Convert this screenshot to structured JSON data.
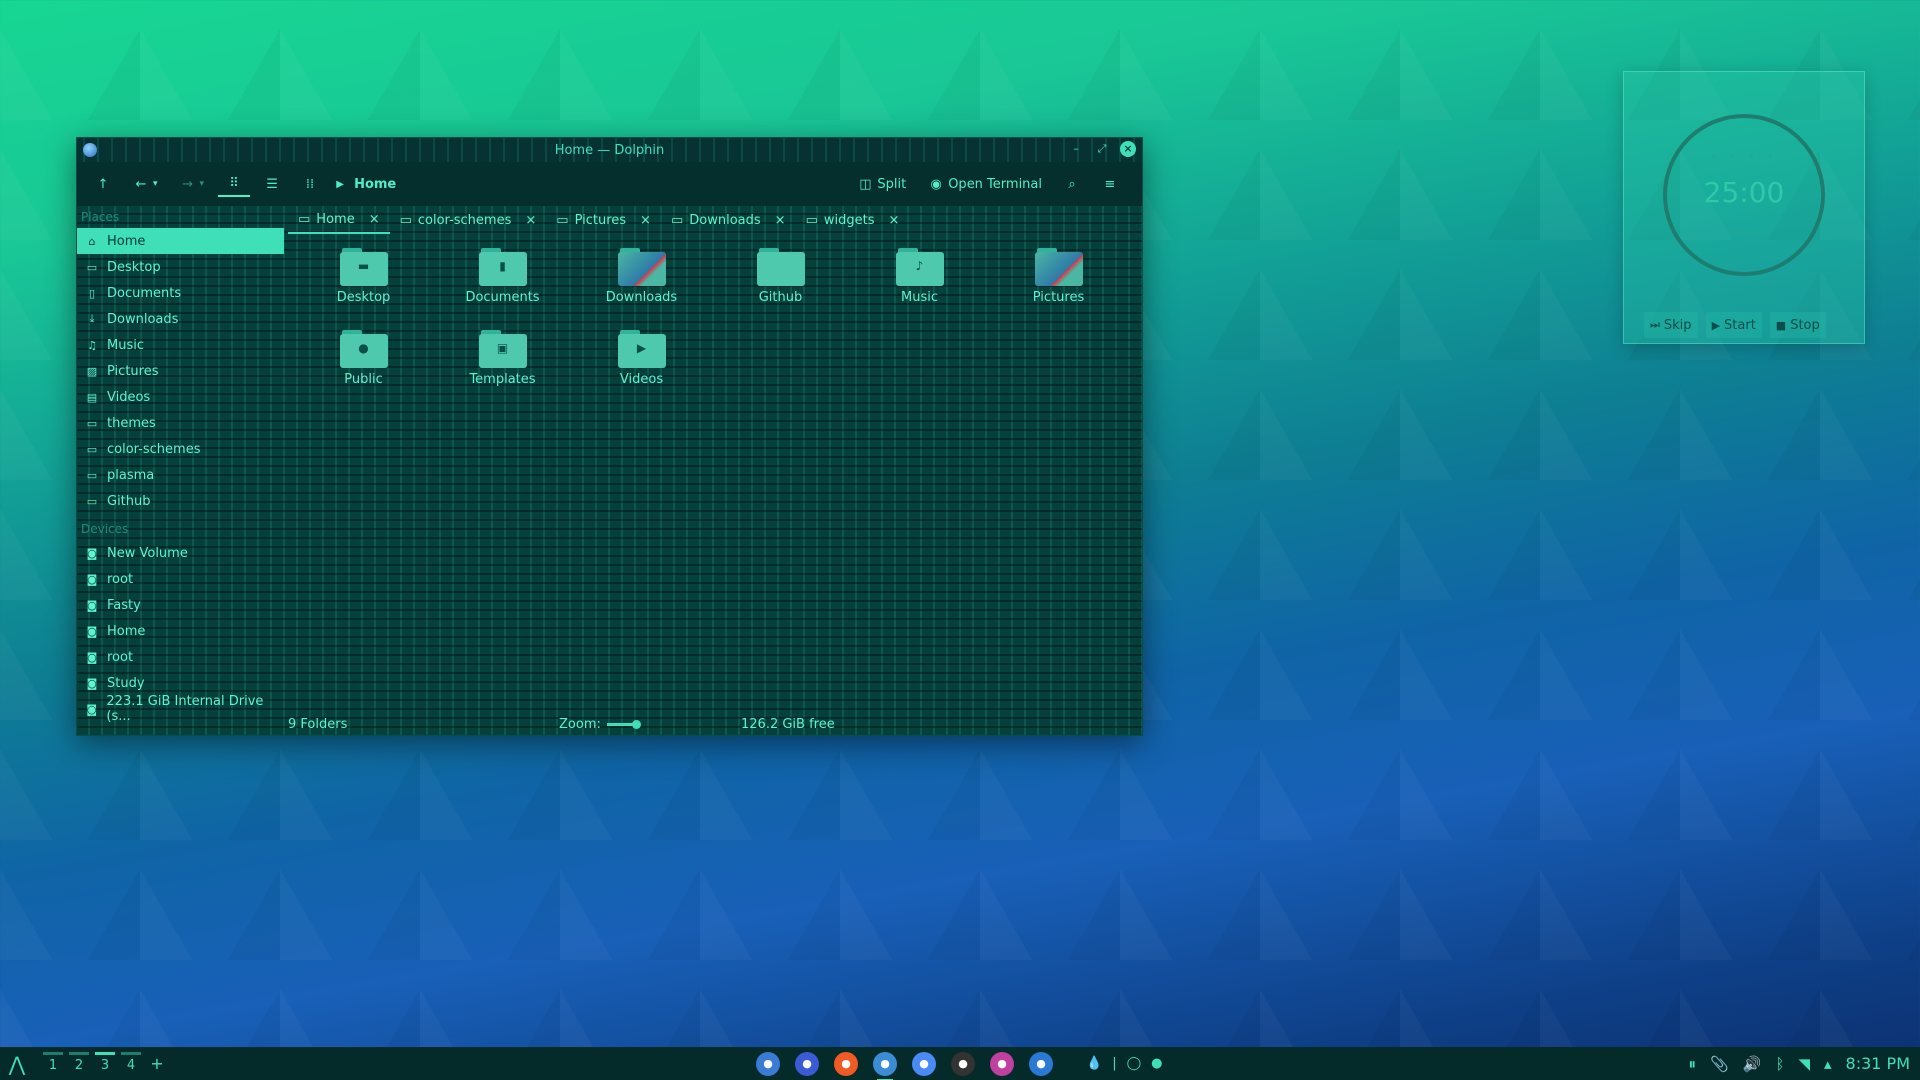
{
  "window": {
    "title": "Home — Dolphin",
    "toolbar": {
      "breadcrumb": "Home",
      "split_label": "Split",
      "terminal_label": "Open Terminal"
    },
    "sidebar": {
      "places_header": "Places",
      "places": [
        {
          "label": "Home",
          "icon": "home-icon",
          "selected": true
        },
        {
          "label": "Desktop",
          "icon": "desktop-icon"
        },
        {
          "label": "Documents",
          "icon": "document-icon"
        },
        {
          "label": "Downloads",
          "icon": "download-icon"
        },
        {
          "label": "Music",
          "icon": "music-icon"
        },
        {
          "label": "Pictures",
          "icon": "image-icon"
        },
        {
          "label": "Videos",
          "icon": "video-icon"
        },
        {
          "label": "themes",
          "icon": "folder-icon"
        },
        {
          "label": "color-schemes",
          "icon": "folder-icon"
        },
        {
          "label": "plasma",
          "icon": "folder-icon"
        },
        {
          "label": "Github",
          "icon": "folder-icon"
        }
      ],
      "devices_header": "Devices",
      "devices": [
        {
          "label": "New Volume",
          "icon": "drive-icon"
        },
        {
          "label": "root",
          "icon": "drive-icon"
        },
        {
          "label": "Fasty",
          "icon": "drive-icon"
        },
        {
          "label": "Home",
          "icon": "drive-icon"
        },
        {
          "label": "root",
          "icon": "drive-icon"
        },
        {
          "label": "Study",
          "icon": "drive-icon"
        },
        {
          "label": "223.1 GiB Internal Drive (s...",
          "icon": "drive-icon"
        }
      ]
    },
    "tabs": [
      {
        "label": "Home",
        "active": true
      },
      {
        "label": "color-schemes"
      },
      {
        "label": "Pictures"
      },
      {
        "label": "Downloads"
      },
      {
        "label": "widgets"
      }
    ],
    "files": [
      {
        "label": "Desktop",
        "emblem": "▬"
      },
      {
        "label": "Documents",
        "emblem": "▮"
      },
      {
        "label": "Downloads",
        "emblem": "",
        "photo": true
      },
      {
        "label": "Github",
        "emblem": ""
      },
      {
        "label": "Music",
        "emblem": "♪"
      },
      {
        "label": "Pictures",
        "emblem": "",
        "photo": true
      },
      {
        "label": "Public",
        "emblem": "●"
      },
      {
        "label": "Templates",
        "emblem": "▣"
      },
      {
        "label": "Videos",
        "emblem": "▶"
      }
    ],
    "status": {
      "count": "9 Folders",
      "zoom_label": "Zoom:",
      "free": "126.2 GiB free"
    }
  },
  "pomodoro": {
    "dots": "• • • •",
    "time": "25:00",
    "mode": "focus",
    "skip": "Skip",
    "start": "Start",
    "stop": "Stop"
  },
  "taskbar": {
    "desktops": [
      "1",
      "2",
      "3",
      "4"
    ],
    "active_desktop": "3",
    "add": "+",
    "clock": "8:31 PM",
    "apps": [
      {
        "icon": "files-icon",
        "color": "#3a7bd5"
      },
      {
        "icon": "mail-icon",
        "color": "#3a5bd5"
      },
      {
        "icon": "brave-icon",
        "color": "#f05a24"
      },
      {
        "icon": "dolphin-icon",
        "color": "#3a8dd5",
        "active": true
      },
      {
        "icon": "chromium-icon",
        "color": "#4a8af4"
      },
      {
        "icon": "inkscape-icon",
        "color": "#333333"
      },
      {
        "icon": "gimp-icon",
        "color": "#c040a0"
      },
      {
        "icon": "vscode-icon",
        "color": "#2a7ad5"
      }
    ]
  },
  "colors": {
    "accent": "#3fe0b8",
    "window_bg": "#063a37",
    "taskbar_bg": "#052a2a"
  }
}
